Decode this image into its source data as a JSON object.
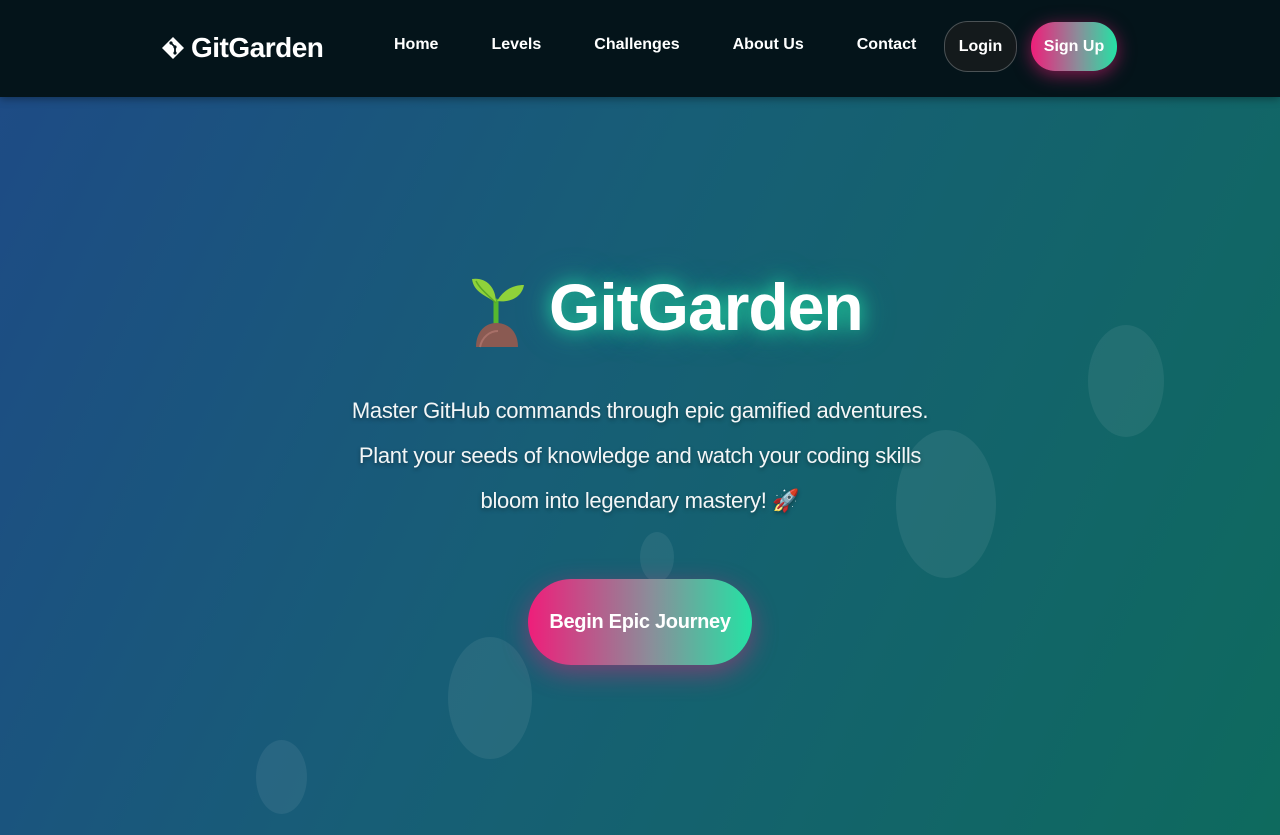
{
  "nav": {
    "brand": "GitGarden",
    "brand_icon": "git-diamond-icon",
    "links": [
      "Home",
      "Levels",
      "Challenges",
      "About Us",
      "Contact"
    ],
    "login_label": "Login",
    "signup_label": "Sign Up"
  },
  "hero": {
    "icon": "sprout-icon",
    "title": "GitGarden",
    "description": "Master GitHub commands through epic gamified adventures. Plant your seeds of knowledge and watch your coding skills bloom into legendary mastery! 🚀",
    "cta_label": "Begin Epic Journey"
  },
  "colors": {
    "nav_bg": "#04141a",
    "accent_pink": "#ef1e7a",
    "accent_green": "#24e2a4",
    "bg_start": "#1e4a86",
    "bg_end": "#0e6a5e"
  }
}
